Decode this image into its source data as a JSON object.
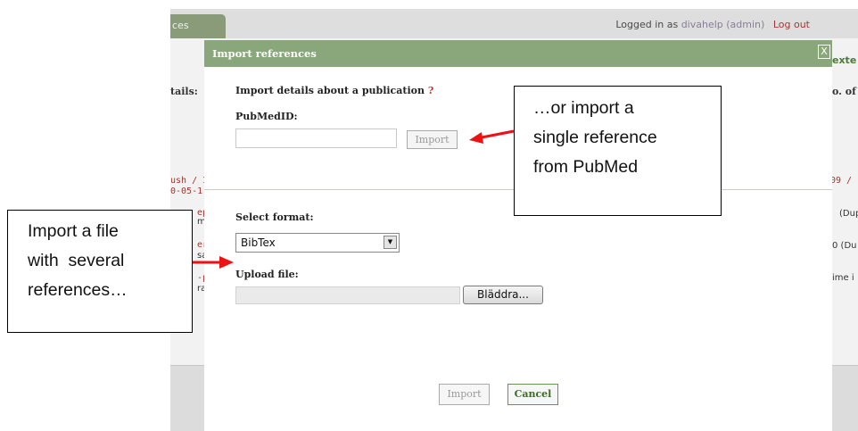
{
  "background": {
    "tab_label": "ces",
    "logged_in_prefix": "Logged in as",
    "user": "divahelp (admin)",
    "logout": "Log out",
    "left_heading": "tails:",
    "right_heading": "o. of",
    "right_tab": "exte",
    "left_fragments": [
      "ush / I",
      "0-05-1",
      "ep",
      "m",
      "er",
      "sa",
      "-p",
      "ra"
    ],
    "right_fragments": [
      "09 /",
      "(Dup",
      "0 (Du",
      "ime i"
    ]
  },
  "modal": {
    "title": "Import references",
    "close_symbol": "X",
    "heading": "Import details about a publication",
    "help_mark": "?",
    "pubmed_label": "PubMedID:",
    "pubmed_value": "",
    "pubmed_import_button": "Import",
    "format_label": "Select format:",
    "format_selected": "BibTex",
    "upload_label": "Upload file:",
    "browse_button": "Bläddra...",
    "import_button": "Import",
    "cancel_button": "Cancel"
  },
  "annotations": {
    "right_callout": [
      "…or import a",
      "single reference",
      "from PubMed"
    ],
    "left_callout": [
      "Import a file",
      "with  several",
      "references…"
    ]
  },
  "colors": {
    "title_bar": "#8aa77c",
    "arrow": "#ee1111",
    "cancel_border": "#6e8f58"
  }
}
